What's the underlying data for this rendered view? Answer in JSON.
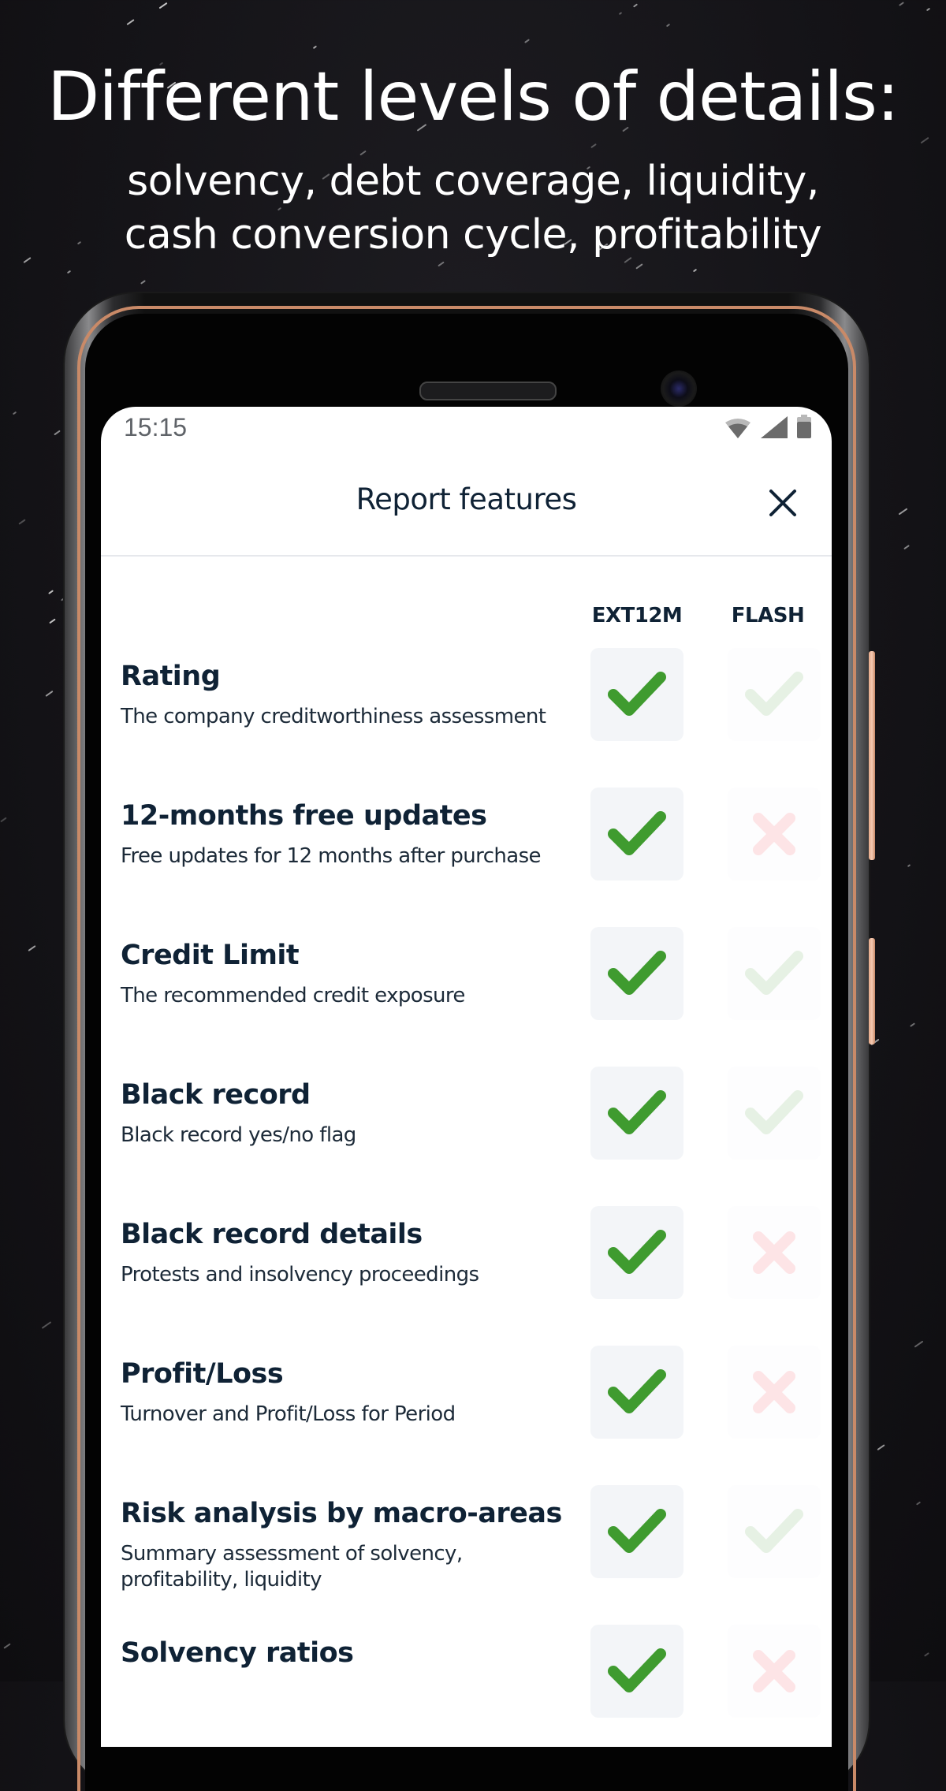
{
  "promo": {
    "title": "Different levels of details:",
    "subtitle_line1": "solvency, debt coverage, liquidity,",
    "subtitle_line2": "cash conversion cycle, profitability"
  },
  "status_bar": {
    "time": "15:15",
    "icons": [
      "wifi-icon",
      "signal-icon",
      "battery-icon"
    ]
  },
  "header": {
    "title": "Report features",
    "close_icon": "close-icon"
  },
  "columns": [
    "EXT12M",
    "FLASH"
  ],
  "colors": {
    "included": "#3f9b2f",
    "included_faded": "#e6f1e4",
    "excluded_faded": "#fde4e6",
    "text_dark": "#0f2235"
  },
  "features": [
    {
      "title": "Rating",
      "description": "The company creditworthiness assessment",
      "ext12m": "included",
      "flash": "included"
    },
    {
      "title": "12-months free updates",
      "description": "Free updates for 12 months after purchase",
      "ext12m": "included",
      "flash": "excluded"
    },
    {
      "title": "Credit Limit",
      "description": "The recommended credit exposure",
      "ext12m": "included",
      "flash": "included"
    },
    {
      "title": "Black record",
      "description": "Black record yes/no flag",
      "ext12m": "included",
      "flash": "included"
    },
    {
      "title": "Black record details",
      "description": "Protests and insolvency proceedings",
      "ext12m": "included",
      "flash": "excluded"
    },
    {
      "title": "Profit/Loss",
      "description": "Turnover and Profit/Loss for Period",
      "ext12m": "included",
      "flash": "excluded"
    },
    {
      "title": "Risk analysis by macro-areas",
      "description": "Summary assessment of solvency, profitability, liquidity",
      "ext12m": "included",
      "flash": "included"
    },
    {
      "title": "Solvency ratios",
      "description": "",
      "ext12m": "included",
      "flash": "excluded"
    }
  ]
}
